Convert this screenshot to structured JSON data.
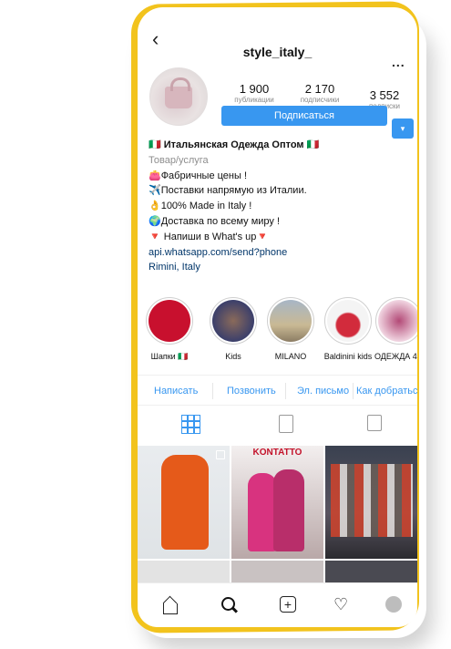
{
  "profile": {
    "username": "style_italy_",
    "back_symbol": "‹",
    "more_symbol": "...",
    "stats": [
      {
        "value": "1 900",
        "label": "публикации"
      },
      {
        "value": "2 170",
        "label": "подписчики"
      },
      {
        "value": "3 552",
        "label": "подписки"
      }
    ],
    "follow_label": "Подписаться",
    "follow_dropdown_symbol": "▾"
  },
  "bio": {
    "lines": [
      "🇮🇹 Итальянская Одежда Оптом 🇮🇹",
      "Товар/услуга",
      "👛Фабричные цены !",
      "✈️Поставки напрямую из Италии.",
      "👌100% Made in Italy !",
      "🌍Доставка по всему миру !",
      "🔻 Напиши в What's up🔻",
      "api.whatsapp.com/send?phone",
      "Rimini, Italy"
    ]
  },
  "highlights": [
    {
      "label": "Шапки 🇮🇹",
      "color": "#c8102e"
    },
    {
      "label": "Kids",
      "color": "#3b3f6b"
    },
    {
      "label": "MILANO",
      "color": "#b9a98a"
    },
    {
      "label": "Baldinini kids",
      "color": "#d22b3c"
    },
    {
      "label": "ОДЕЖДА 4...",
      "color": "#b34a77"
    }
  ],
  "actions": [
    "Написать",
    "Позвонить",
    "Эл. письмо",
    "Как добраться"
  ],
  "grid_posts": [
    {
      "caption": ""
    },
    {
      "caption": "KONTATTO"
    },
    {
      "caption": ""
    }
  ],
  "colors": {
    "accent": "#3897f0",
    "frame": "#f2c31d"
  }
}
